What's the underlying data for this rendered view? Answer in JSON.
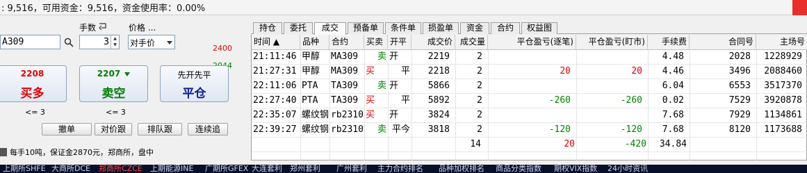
{
  "account": {
    "summary": ": 9,516，可用资金：9,516，资金使用率：0.00%"
  },
  "order_panel": {
    "contract_code": "A309",
    "qty_label": "手数",
    "qty_value": "3",
    "price_label": "价格 ...",
    "price_type": "对手价",
    "limit_up": "2400",
    "limit_down": "2044",
    "buy": {
      "price": "2208",
      "action": "买多",
      "sub": "<= 3"
    },
    "sell": {
      "price": "2207",
      "action": "卖空",
      "sub": "<= 3"
    },
    "close": {
      "rule": "先开先平",
      "action": "平仓"
    },
    "buttons": [
      "撤单",
      "对价跟",
      "排队跟",
      "连续追"
    ],
    "info": "每手10吨，保证金2870元，郑商所，盘中"
  },
  "tabs": [
    "持仓",
    "委托",
    "成交",
    "预备单",
    "条件单",
    "损盈单",
    "资金",
    "合约",
    "权益图"
  ],
  "active_tab": "成交",
  "table": {
    "columns": [
      "时间 ▲",
      "品种",
      "合约",
      "买卖",
      "开平",
      "成交价",
      "成交量",
      "平仓盈亏(逐笔)",
      "平仓盈亏(盯市)",
      "手续费",
      "合同号",
      "主场号"
    ],
    "rows": [
      [
        "21:11:46",
        "甲醇",
        "MA309",
        "卖",
        "开",
        "2219",
        "2",
        "",
        "",
        "4.48",
        "2028",
        "1228929"
      ],
      [
        "21:27:31",
        "甲醇",
        "MA309",
        "买",
        "平",
        "2218",
        "2",
        "20",
        "20",
        "4.46",
        "3496",
        "2088460"
      ],
      [
        "22:11:06",
        "PTA",
        "TA309",
        "卖",
        "开",
        "5866",
        "2",
        "",
        "",
        "6.04",
        "6553",
        "3517370"
      ],
      [
        "22:27:40",
        "PTA",
        "TA309",
        "买",
        "平",
        "5892",
        "2",
        "-260",
        "-260",
        "0.02",
        "7529",
        "3920878"
      ],
      [
        "22:35:07",
        "螺纹钢",
        "rb2310",
        "买",
        "开",
        "3824",
        "2",
        "",
        "",
        "7.68",
        "7929",
        "1134861"
      ],
      [
        "22:39:27",
        "螺纹钢",
        "rb2310",
        "卖",
        "平今",
        "3818",
        "2",
        "-120",
        "-120",
        "7.68",
        "8120",
        "1173688"
      ]
    ],
    "totals": {
      "volume": "14",
      "pnl_trade": "20",
      "pnl_mark": "-420",
      "fee": "34.84"
    }
  },
  "ticker": [
    "上期所SHFE",
    "大商所DCE",
    "郑商所CZCE",
    "上期能源INE",
    "广期所GFEX",
    "大连套利",
    "郑州套利",
    "广州套利",
    "主力合约排名",
    "品种加权排名",
    "商品分类指数",
    "期权VIX指数",
    "24小时资讯"
  ],
  "colors": {
    "up": "#e00000",
    "down": "#008000",
    "ticker_bg": "#0a0f28"
  }
}
